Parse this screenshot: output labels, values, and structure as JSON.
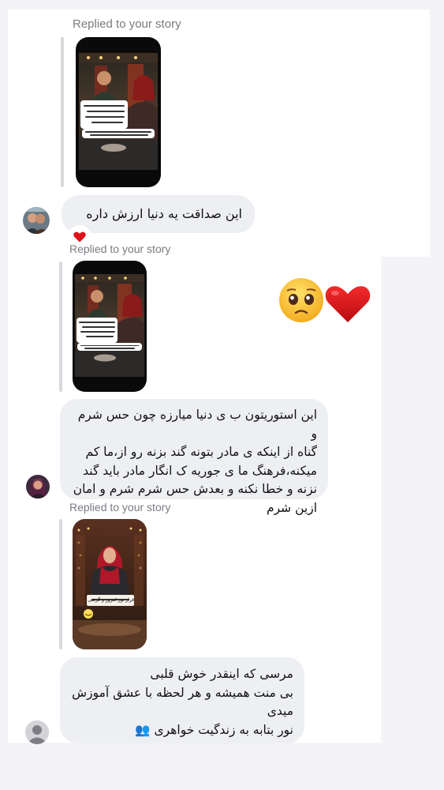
{
  "colors": {
    "bubble": "#eeeff2",
    "meta_text": "#7a7a82",
    "reaction_red": "#e0101a",
    "band": "#f4f4f6"
  },
  "threads": [
    {
      "replied_label": "Replied to your story",
      "message": "این صداقت یه دنیا ارزش داره",
      "reaction": "❤️",
      "avatar_icon": "user-photo-avatar"
    },
    {
      "replied_label": "Replied to your story",
      "message_lines": [
        "این استوریتون ب ی دنیا میارزه چون حس شرم و",
        "گناه از اینکه ی مادر بتونه گند بزنه رو از،ما کم",
        "میکنه،فرهنگ ما ی جوریه ک انگار مادر باید گند",
        "نزنه و خطا نکنه و بعدش حس شرم شرم و امان",
        "ازین شرم"
      ],
      "sticker": "🥹❤️",
      "avatar_icon": "user-photo-avatar"
    },
    {
      "replied_label": "Replied to your story",
      "story_caption": "قرار نور امروز و گرفتی رفیق؟",
      "message_lines": [
        "مرسی که اینقدر خوش قلبی",
        "بی منت همیشه و هر لحظه با عشق آموزش",
        "میدی",
        "نور بتابه به زندگیت خواهری 👥"
      ],
      "avatar_icon": "default-user-avatar"
    }
  ]
}
